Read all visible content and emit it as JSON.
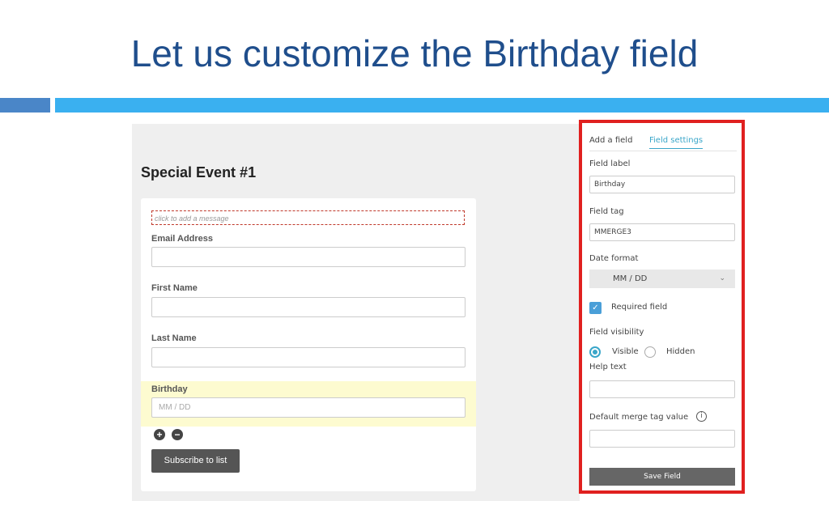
{
  "slide": {
    "title": "Let us customize the Birthday field"
  },
  "form": {
    "title": "Special Event #1",
    "message_placeholder": "click to add a message",
    "fields": [
      {
        "label": "Email Address",
        "value": ""
      },
      {
        "label": "First Name",
        "value": ""
      },
      {
        "label": "Last Name",
        "value": ""
      },
      {
        "label": "Birthday",
        "placeholder": "MM / DD"
      }
    ],
    "add_icon": "plus-circle-icon",
    "remove_icon": "minus-circle-icon",
    "subscribe_label": "Subscribe to list"
  },
  "panel": {
    "tabs": [
      {
        "label": "Add a field",
        "active": false
      },
      {
        "label": "Field settings",
        "active": true
      }
    ],
    "field_label": {
      "label": "Field label",
      "value": "Birthday"
    },
    "field_tag": {
      "label": "Field tag",
      "value": "MMERGE3"
    },
    "date_format": {
      "label": "Date format",
      "value": "MM / DD"
    },
    "required": {
      "label": "Required field",
      "checked": true
    },
    "visibility": {
      "label": "Field visibility",
      "options": [
        {
          "label": "Visible",
          "selected": true
        },
        {
          "label": "Hidden",
          "selected": false
        }
      ]
    },
    "help_text": {
      "label": "Help text",
      "value": ""
    },
    "default_merge": {
      "label": "Default merge tag value",
      "value": ""
    },
    "save_label": "Save Field"
  },
  "colors": {
    "title": "#1f4e8c",
    "accent": "#3aa6c9",
    "highlight_border": "#e0201f",
    "bar_dark": "#4a86c8",
    "bar_light": "#3ab0f0",
    "field_highlight": "#fdfbd0"
  }
}
